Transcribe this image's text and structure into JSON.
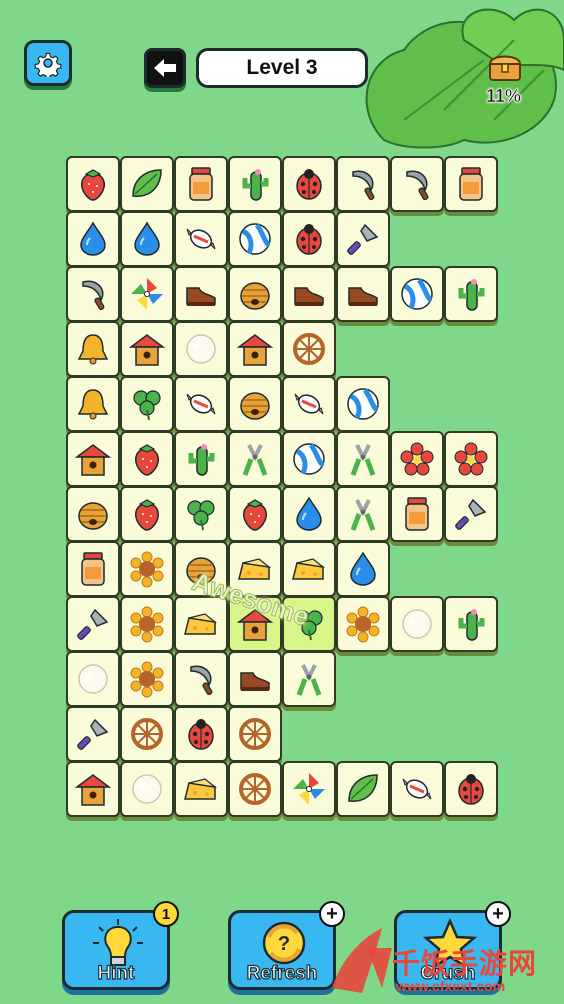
{
  "header": {
    "level_title": "Level 3",
    "progress_text": "11%",
    "progress_value": 11
  },
  "board": {
    "rows": [
      [
        "strawberry",
        "leaf",
        "jar",
        "cactus",
        "ladybug",
        "sickle",
        "sickle",
        "jar"
      ],
      [
        "drop",
        "drop",
        "candy",
        "ball",
        "ladybug",
        "trowel",
        null,
        null
      ],
      [
        "sickle",
        "pinwheel",
        "shoe",
        "beehive",
        "shoe",
        "shoe",
        "ball",
        "cactus"
      ],
      [
        "bell",
        "birdhouse",
        "cotton",
        "birdhouse",
        "wheel",
        null,
        null,
        null
      ],
      [
        "bell",
        "clover",
        "candy",
        "beehive",
        "candy",
        "ball",
        null,
        null
      ],
      [
        "birdhouse",
        "strawberry",
        "cactus",
        "pliers",
        "ball",
        "pliers",
        "flower",
        "flower"
      ],
      [
        "beehive",
        "strawberry",
        "clover",
        "strawberry",
        "drop",
        "pliers",
        "jar",
        "trowel"
      ],
      [
        "jar",
        "sunflower",
        "beehive",
        "cheese",
        "cheese",
        "drop",
        null,
        null
      ],
      [
        "trowel",
        "sunflower",
        "cheese",
        "birdhouse",
        "clover",
        "sunflower",
        "cotton",
        "cactus"
      ],
      [
        "cotton",
        "sunflower",
        "sickle",
        "shoe",
        "pliers",
        null,
        null,
        null
      ],
      [
        "trowel",
        "wheel",
        "ladybug",
        "wheel",
        null,
        null,
        null,
        null
      ],
      [
        "birdhouse",
        "cotton",
        "cheese",
        "wheel",
        "pinwheel",
        "leaf",
        "candy",
        "ladybug"
      ]
    ]
  },
  "feedback": {
    "text": "Awesome"
  },
  "buttons": {
    "hint_label": "Hint",
    "hint_count": "1",
    "refresh_label": "Refresh",
    "crush_label": "Crush",
    "plus": "+"
  },
  "watermark": {
    "text": "千饭手游网",
    "url": "www.cfxext.com"
  },
  "colors": {
    "background": "#7fd88a",
    "button": "#38b7f0",
    "tile": "#fafbd9"
  }
}
